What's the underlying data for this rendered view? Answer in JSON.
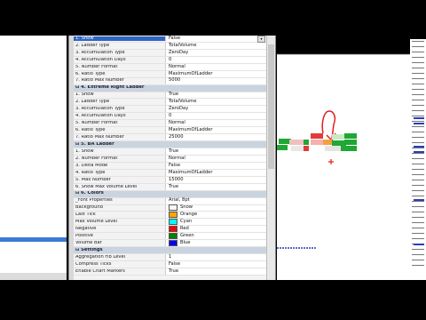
{
  "grid": {
    "rows": [
      {
        "type": "prop",
        "key": "1. Show",
        "value": "False",
        "selected": true,
        "dropdown": true
      },
      {
        "type": "prop",
        "key": "2. Ladder Type",
        "value": "TotalVolume"
      },
      {
        "type": "prop",
        "key": "3. Accumulation Type",
        "value": "ZeroDay"
      },
      {
        "type": "prop",
        "key": "4. Accumulation Days",
        "value": "0"
      },
      {
        "type": "prop",
        "key": "5. Number Format",
        "value": "Normal"
      },
      {
        "type": "prop",
        "key": "6. Ratio Type",
        "value": "MaximumOfLadder"
      },
      {
        "type": "prop",
        "key": "7. Ratio Max Number",
        "value": "5000"
      },
      {
        "type": "cat",
        "key": "4. Extreme Right Ladder"
      },
      {
        "type": "prop",
        "key": "1. Show",
        "value": "True"
      },
      {
        "type": "prop",
        "key": "2. Ladder Type",
        "value": "TotalVolume"
      },
      {
        "type": "prop",
        "key": "3. Accumulation Type",
        "value": "ZeroDay"
      },
      {
        "type": "prop",
        "key": "4. Accumulation Days",
        "value": "0"
      },
      {
        "type": "prop",
        "key": "5. Number Format",
        "value": "Normal"
      },
      {
        "type": "prop",
        "key": "6. Ratio Type",
        "value": "MaximumOfLadder"
      },
      {
        "type": "prop",
        "key": "7. Ratio Max Number",
        "value": "25000"
      },
      {
        "type": "cat",
        "key": "5. BA Ladder"
      },
      {
        "type": "prop",
        "key": "1. Show",
        "value": "True"
      },
      {
        "type": "prop",
        "key": "2. Number Format",
        "value": "Normal"
      },
      {
        "type": "prop",
        "key": "3. Delta Mode",
        "value": "False"
      },
      {
        "type": "prop",
        "key": "4. Ratio Type",
        "value": "MaximumOfLadder"
      },
      {
        "type": "prop",
        "key": "5. Max Number",
        "value": "15000"
      },
      {
        "type": "prop",
        "key": "6. Show Max Volume Level",
        "value": "True"
      },
      {
        "type": "cat",
        "key": "6. Colors"
      },
      {
        "type": "prop",
        "key": "_Font Properties",
        "value": "Arial, 8pt"
      },
      {
        "type": "prop",
        "key": "Background",
        "value": "Snow",
        "color": "#fffafa"
      },
      {
        "type": "prop",
        "key": "Last Tick",
        "value": "Orange",
        "color": "#ffa500"
      },
      {
        "type": "prop",
        "key": "Max Volume Level",
        "value": "Cyan",
        "color": "#00ffff"
      },
      {
        "type": "prop",
        "key": "Negative",
        "value": "Red",
        "color": "#ff0000"
      },
      {
        "type": "prop",
        "key": "Positive",
        "value": "Green",
        "color": "#008000"
      },
      {
        "type": "prop",
        "key": "Volume Bar",
        "value": "Blue",
        "color": "#0000ff"
      },
      {
        "type": "cat",
        "key": "Settings"
      },
      {
        "type": "prop",
        "key": "Aggregation Fib Level",
        "value": "1"
      },
      {
        "type": "prop",
        "key": "Compress Ticks",
        "value": "False"
      },
      {
        "type": "prop",
        "key": "Enable Chart Markers",
        "value": "True"
      }
    ]
  },
  "colors": {
    "category_bg": "#c9d4e0",
    "selection": "#3163c5",
    "ladder_green": "#1fa834",
    "ladder_red": "#e23b3b",
    "ladder_orange": "#f2a23a",
    "chart_blue": "#2a3eb8",
    "annotation_red": "#e0211f"
  }
}
